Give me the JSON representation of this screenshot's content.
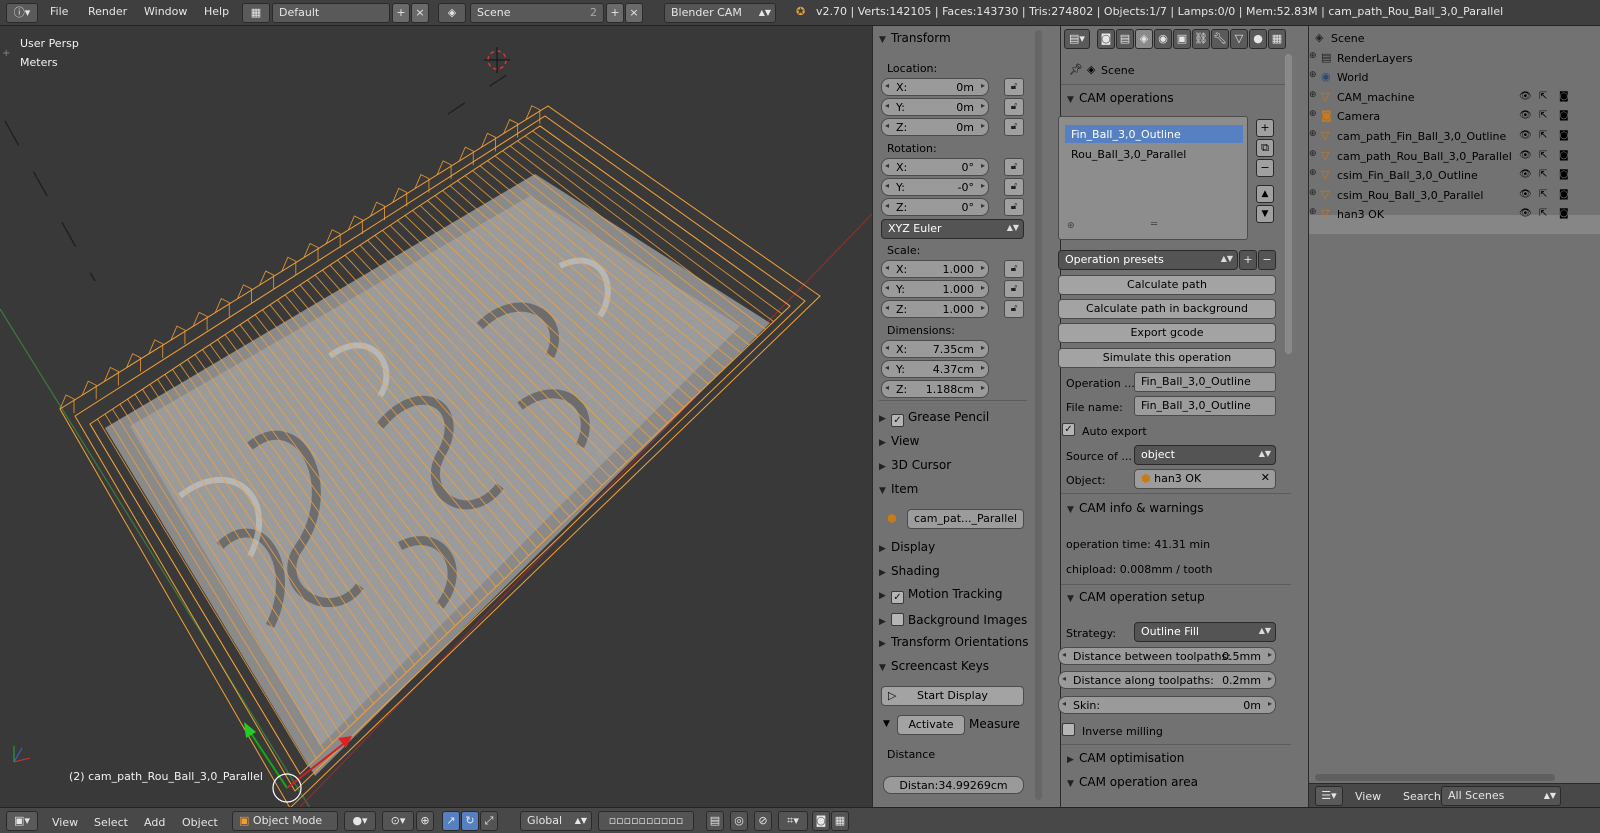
{
  "topbar": {
    "menus": [
      "File",
      "Render",
      "Window",
      "Help"
    ],
    "layout": "Default",
    "scene": "Scene",
    "scene_users": "2",
    "engine": "Blender CAM",
    "stats": "v2.70 | Verts:142105 | Faces:143730 | Tris:274802 | Objects:1/7 | Lamps:0/0 | Mem:52.83M | cam_path_Rou_Ball_3,0_Parallel"
  },
  "viewport": {
    "view_name": "User Persp",
    "units": "Meters",
    "active_object": "(2) cam_path_Rou_Ball_3,0_Parallel"
  },
  "bottombar": {
    "menus": [
      "View",
      "Select",
      "Add",
      "Object"
    ],
    "mode": "Object Mode",
    "orientation": "Global"
  },
  "npanel": {
    "transform": "Transform",
    "location_label": "Location:",
    "location": [
      {
        "axis": "X:",
        "value": "0m"
      },
      {
        "axis": "Y:",
        "value": "0m"
      },
      {
        "axis": "Z:",
        "value": "0m"
      }
    ],
    "rotation_label": "Rotation:",
    "rotation": [
      {
        "axis": "X:",
        "value": "0°"
      },
      {
        "axis": "Y:",
        "value": "-0°"
      },
      {
        "axis": "Z:",
        "value": "0°"
      }
    ],
    "rotation_mode": "XYZ Euler",
    "scale_label": "Scale:",
    "scale": [
      {
        "axis": "X:",
        "value": "1.000"
      },
      {
        "axis": "Y:",
        "value": "1.000"
      },
      {
        "axis": "Z:",
        "value": "1.000"
      }
    ],
    "dimensions_label": "Dimensions:",
    "dimensions": [
      {
        "axis": "X:",
        "value": "7.35cm"
      },
      {
        "axis": "Y:",
        "value": "4.37cm"
      },
      {
        "axis": "Z:",
        "value": "1.188cm"
      }
    ],
    "grease_pencil": "Grease Pencil",
    "view": "View",
    "cursor": "3D Cursor",
    "item": "Item",
    "item_name": "cam_pat..._Parallel",
    "display": "Display",
    "shading": "Shading",
    "motion_tracking": "Motion Tracking",
    "background_images": "Background Images",
    "transform_orientations": "Transform Orientations",
    "screencast_keys": "Screencast Keys",
    "start_display": "Start Display",
    "activate": "Activate",
    "measure": "Measure",
    "distance_label": "Distance",
    "distance_value": "Distan:34.99269cm"
  },
  "properties": {
    "breadcrumb": "Scene",
    "cam_operations": "CAM operations",
    "operations": [
      "Fin_Ball_3,0_Outline",
      "Rou_Ball_3,0_Parallel"
    ],
    "operation_presets": "Operation presets",
    "calculate_path": "Calculate path",
    "calculate_bg": "Calculate path in background",
    "export_gcode": "Export gcode",
    "simulate": "Simulate this operation",
    "operation_label": "Operation ...",
    "operation_value": "Fin_Ball_3,0_Outline",
    "filename_label": "File name:",
    "filename_value": "Fin_Ball_3,0_Outline",
    "auto_export": "Auto export",
    "source_label": "Source of ...",
    "source_value": "object",
    "object_label": "Object:",
    "object_value": "han3 OK",
    "cam_info": "CAM info & warnings",
    "op_time": "operation time: 41.31 min",
    "chipload": "chipload: 0.008mm / tooth",
    "setup": "CAM operation setup",
    "strategy_label": "Strategy:",
    "strategy_value": "Outline Fill",
    "dist_between_label": "Distance between toolpaths:",
    "dist_between_value": "0.5mm",
    "dist_along_label": "Distance along toolpaths:",
    "dist_along_value": "0.2mm",
    "skin_label": "Skin:",
    "skin_value": "0m",
    "inverse": "Inverse milling",
    "optimisation": "CAM optimisation",
    "area": "CAM operation area"
  },
  "outliner": {
    "rows": [
      {
        "name": "Scene",
        "icon": "scene-icon"
      },
      {
        "name": "RenderLayers",
        "icon": "renderlayers-icon"
      },
      {
        "name": "World",
        "icon": "world-icon"
      },
      {
        "name": "CAM_machine",
        "icon": "mesh-icon"
      },
      {
        "name": "Camera",
        "icon": "camera-icon"
      },
      {
        "name": "cam_path_Fin_Ball_3,0_Outline",
        "icon": "mesh-icon"
      },
      {
        "name": "cam_path_Rou_Ball_3,0_Parallel",
        "icon": "mesh-icon"
      },
      {
        "name": "csim_Fin_Ball_3,0_Outline",
        "icon": "mesh-icon"
      },
      {
        "name": "csim_Rou_Ball_3,0_Parallel",
        "icon": "mesh-icon"
      },
      {
        "name": "han3 OK",
        "icon": "mesh-icon"
      }
    ],
    "footer": {
      "view": "View",
      "search": "Search",
      "scenes": "All Scenes"
    }
  },
  "colors": {
    "accent": "#f0a030",
    "selection": "#5680c2",
    "panel": "#727272",
    "viewport": "#393939"
  }
}
